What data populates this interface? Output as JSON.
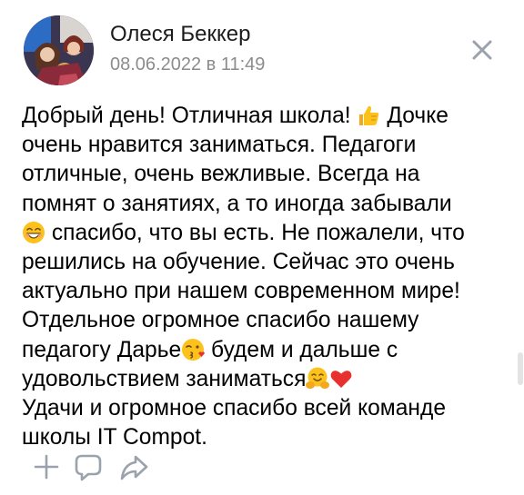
{
  "post": {
    "author": "Олеся Беккер",
    "date": "08.06.2022 в 11:49",
    "lines": [
      {
        "segments": [
          {
            "text": "Добрый день! Отличная школа! "
          },
          {
            "icon": "thumbs-up-emoji"
          },
          {
            "text": " Дочке"
          }
        ]
      },
      {
        "segments": [
          {
            "text": "очень нравится заниматься. Педагоги"
          }
        ]
      },
      {
        "segments": [
          {
            "text": "отличные, очень вежливые. Всегда на"
          }
        ]
      },
      {
        "segments": [
          {
            "text": "помнят о занятиях, а то иногда забывали"
          }
        ]
      },
      {
        "segments": [
          {
            "icon": "grinning-face-emoji"
          },
          {
            "text": " спасибо, что вы есть. Не пожалели, что"
          }
        ]
      },
      {
        "segments": [
          {
            "text": "решились на обучение. Сейчас это очень"
          }
        ]
      },
      {
        "segments": [
          {
            "text": "актуально при нашем современном мире!"
          }
        ]
      },
      {
        "segments": [
          {
            "text": "Отдельное огромное спасибо нашему"
          }
        ]
      },
      {
        "segments": [
          {
            "text": "педагогу Дарье"
          },
          {
            "icon": "kissing-face-emoji"
          },
          {
            "text": " будем и дальше с"
          }
        ]
      },
      {
        "segments": [
          {
            "text": "удовольствием заниматься"
          },
          {
            "icon": "hugging-face-emoji"
          },
          {
            "icon": "red-heart-emoji"
          }
        ]
      },
      {
        "segments": [
          {
            "text": "Удачи и огромное спасибо всей команде"
          }
        ]
      },
      {
        "segments": [
          {
            "text": "школы IT Compot."
          }
        ]
      }
    ]
  },
  "icons": {
    "close": "close-icon",
    "actions": [
      "plus-icon",
      "comment-icon",
      "share-icon"
    ]
  },
  "colors": {
    "text": "#000000",
    "secondary_text": "#8c8c8c",
    "icon": "#99a2ad"
  }
}
